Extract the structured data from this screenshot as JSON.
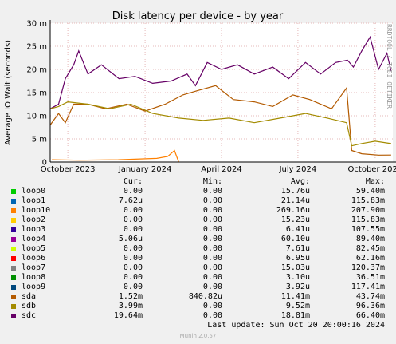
{
  "chart_data": {
    "type": "line",
    "title": "Disk latency per device - by year",
    "ylabel": "Average IO Wait (seconds)",
    "ylim": [
      0,
      0.03
    ],
    "yticks": [
      {
        "v": 0,
        "label": "0"
      },
      {
        "v": 0.005,
        "label": "5 m"
      },
      {
        "v": 0.01,
        "label": "10 m"
      },
      {
        "v": 0.015,
        "label": "15 m"
      },
      {
        "v": 0.02,
        "label": "20 m"
      },
      {
        "v": 0.025,
        "label": "25 m"
      },
      {
        "v": 0.03,
        "label": "30 m"
      }
    ],
    "xlim": [
      "2023-09-10",
      "2024-10-22"
    ],
    "xticks": [
      {
        "date": "2023-10-01",
        "label": "October 2023"
      },
      {
        "date": "2024-01-01",
        "label": "January 2024"
      },
      {
        "date": "2024-04-01",
        "label": "April 2024"
      },
      {
        "date": "2024-07-01",
        "label": "July 2024"
      },
      {
        "date": "2024-10-01",
        "label": "October 2024"
      }
    ],
    "grid": true,
    "series": [
      {
        "name": "sdc",
        "color": "#660066",
        "values": [
          [
            "2023-09-10",
            0.0115
          ],
          [
            "2023-09-20",
            0.0125
          ],
          [
            "2023-09-28",
            0.018
          ],
          [
            "2023-10-08",
            0.021
          ],
          [
            "2023-10-14",
            0.024
          ],
          [
            "2023-10-25",
            0.019
          ],
          [
            "2023-11-10",
            0.021
          ],
          [
            "2023-12-01",
            0.018
          ],
          [
            "2023-12-20",
            0.0185
          ],
          [
            "2024-01-10",
            0.017
          ],
          [
            "2024-02-01",
            0.0175
          ],
          [
            "2024-02-20",
            0.019
          ],
          [
            "2024-03-01",
            0.0165
          ],
          [
            "2024-03-15",
            0.0215
          ],
          [
            "2024-04-01",
            0.02
          ],
          [
            "2024-04-20",
            0.021
          ],
          [
            "2024-05-10",
            0.019
          ],
          [
            "2024-06-01",
            0.0205
          ],
          [
            "2024-06-20",
            0.018
          ],
          [
            "2024-07-10",
            0.0215
          ],
          [
            "2024-07-28",
            0.019
          ],
          [
            "2024-08-15",
            0.0215
          ],
          [
            "2024-08-29",
            0.022
          ],
          [
            "2024-09-05",
            0.0205
          ],
          [
            "2024-09-15",
            0.024
          ],
          [
            "2024-09-25",
            0.027
          ],
          [
            "2024-10-05",
            0.02
          ],
          [
            "2024-10-15",
            0.0235
          ],
          [
            "2024-10-20",
            0.0196
          ]
        ]
      },
      {
        "name": "sda",
        "color": "#b35a00",
        "values": [
          [
            "2023-09-10",
            0.008
          ],
          [
            "2023-09-20",
            0.0105
          ],
          [
            "2023-09-28",
            0.0085
          ],
          [
            "2023-10-08",
            0.0125
          ],
          [
            "2023-10-25",
            0.0125
          ],
          [
            "2023-11-15",
            0.0115
          ],
          [
            "2023-12-10",
            0.0125
          ],
          [
            "2024-01-01",
            0.011
          ],
          [
            "2024-01-25",
            0.0125
          ],
          [
            "2024-02-15",
            0.0145
          ],
          [
            "2024-03-05",
            0.0155
          ],
          [
            "2024-03-25",
            0.0165
          ],
          [
            "2024-04-15",
            0.0135
          ],
          [
            "2024-05-10",
            0.013
          ],
          [
            "2024-06-01",
            0.012
          ],
          [
            "2024-06-25",
            0.0145
          ],
          [
            "2024-07-15",
            0.0135
          ],
          [
            "2024-08-10",
            0.0115
          ],
          [
            "2024-08-28",
            0.016
          ],
          [
            "2024-09-03",
            0.0025
          ],
          [
            "2024-09-15",
            0.0018
          ],
          [
            "2024-10-05",
            0.0015
          ],
          [
            "2024-10-20",
            0.00152
          ]
        ]
      },
      {
        "name": "sdb",
        "color": "#a38b00",
        "values": [
          [
            "2023-09-10",
            0.0115
          ],
          [
            "2023-09-20",
            0.012
          ],
          [
            "2023-10-01",
            0.013
          ],
          [
            "2023-10-25",
            0.0125
          ],
          [
            "2023-11-20",
            0.0115
          ],
          [
            "2023-12-15",
            0.0125
          ],
          [
            "2024-01-10",
            0.0105
          ],
          [
            "2024-02-10",
            0.0095
          ],
          [
            "2024-03-10",
            0.009
          ],
          [
            "2024-04-10",
            0.0095
          ],
          [
            "2024-05-10",
            0.0085
          ],
          [
            "2024-06-10",
            0.0095
          ],
          [
            "2024-07-10",
            0.0105
          ],
          [
            "2024-08-05",
            0.0095
          ],
          [
            "2024-08-28",
            0.0085
          ],
          [
            "2024-09-03",
            0.0035
          ],
          [
            "2024-09-15",
            0.004
          ],
          [
            "2024-10-01",
            0.0045
          ],
          [
            "2024-10-20",
            0.00399
          ]
        ]
      },
      {
        "name": "loop10",
        "color": "#ff8000",
        "values": [
          [
            "2023-09-12",
            0.0005
          ],
          [
            "2023-10-15",
            0.0004
          ],
          [
            "2023-11-30",
            0.0005
          ],
          [
            "2024-01-15",
            0.0008
          ],
          [
            "2024-01-28",
            0.0012
          ],
          [
            "2024-02-05",
            0.0025
          ],
          [
            "2024-02-10",
            0.0
          ]
        ]
      }
    ]
  },
  "side_label": "RRDTOOL / TOBI OETIKER",
  "legend": {
    "headers": {
      "cur": "Cur:",
      "min": "Min:",
      "avg": "Avg:",
      "max": "Max:"
    },
    "rows": [
      {
        "name": "loop0",
        "color": "#00cc00",
        "cur": "0.00",
        "min": "0.00",
        "avg": "15.76u",
        "max": "59.40m"
      },
      {
        "name": "loop1",
        "color": "#0066b3",
        "cur": "7.62u",
        "min": "0.00",
        "avg": "21.14u",
        "max": "115.83m"
      },
      {
        "name": "loop10",
        "color": "#ff8000",
        "cur": "0.00",
        "min": "0.00",
        "avg": "269.16u",
        "max": "207.90m"
      },
      {
        "name": "loop2",
        "color": "#ffcc00",
        "cur": "0.00",
        "min": "0.00",
        "avg": "15.23u",
        "max": "115.83m"
      },
      {
        "name": "loop3",
        "color": "#330099",
        "cur": "0.00",
        "min": "0.00",
        "avg": "6.41u",
        "max": "107.55m"
      },
      {
        "name": "loop4",
        "color": "#990099",
        "cur": "5.06u",
        "min": "0.00",
        "avg": "60.10u",
        "max": "89.40m"
      },
      {
        "name": "loop5",
        "color": "#ccff00",
        "cur": "0.00",
        "min": "0.00",
        "avg": "7.61u",
        "max": "82.45m"
      },
      {
        "name": "loop6",
        "color": "#ff0000",
        "cur": "0.00",
        "min": "0.00",
        "avg": "6.95u",
        "max": "62.16m"
      },
      {
        "name": "loop7",
        "color": "#808080",
        "cur": "0.00",
        "min": "0.00",
        "avg": "15.03u",
        "max": "120.37m"
      },
      {
        "name": "loop8",
        "color": "#008f00",
        "cur": "0.00",
        "min": "0.00",
        "avg": "3.10u",
        "max": "36.51m"
      },
      {
        "name": "loop9",
        "color": "#00487d",
        "cur": "0.00",
        "min": "0.00",
        "avg": "3.92u",
        "max": "117.41m"
      },
      {
        "name": "sda",
        "color": "#b35a00",
        "cur": "1.52m",
        "min": "840.82u",
        "avg": "11.41m",
        "max": "43.74m"
      },
      {
        "name": "sdb",
        "color": "#a38b00",
        "cur": "3.99m",
        "min": "0.00",
        "avg": "9.52m",
        "max": "96.36m"
      },
      {
        "name": "sdc",
        "color": "#660066",
        "cur": "19.64m",
        "min": "0.00",
        "avg": "18.81m",
        "max": "66.40m"
      }
    ]
  },
  "last_update": "Last update: Sun Oct 20 20:00:16 2024",
  "footer": "Munin 2.0.57"
}
